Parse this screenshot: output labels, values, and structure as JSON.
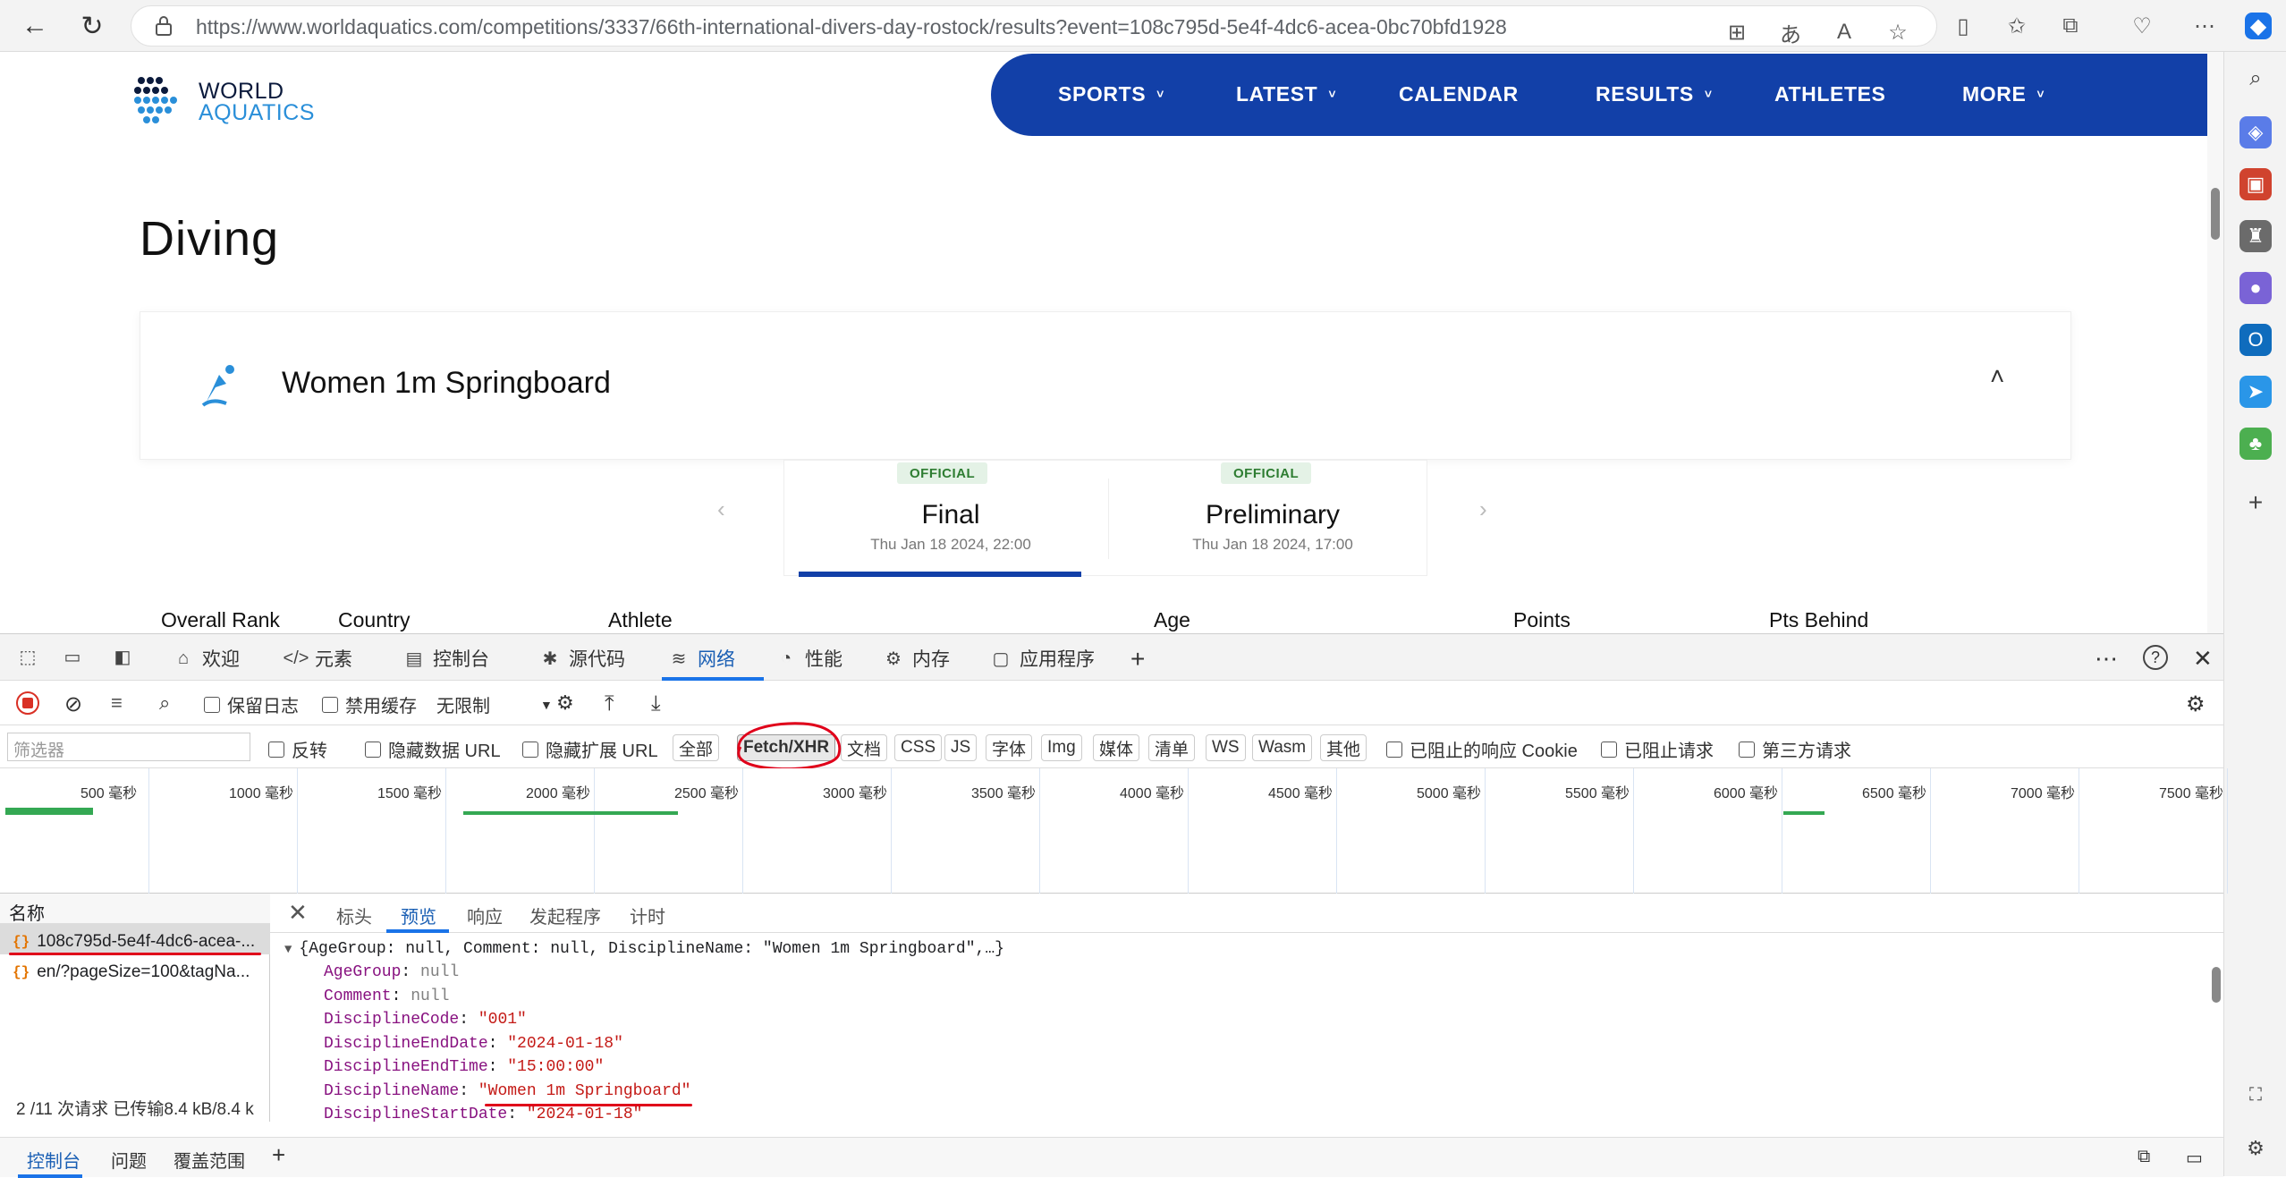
{
  "browser": {
    "url": "https://www.worldaquatics.com/competitions/3337/66th-international-divers-day-rostock/results?event=108c795d-5e4f-4dc6-acea-0bc70bfd1928"
  },
  "site": {
    "logo_line1": "WORLD",
    "logo_line2": "AQUATICS",
    "nav": [
      "SPORTS",
      "LATEST",
      "CALENDAR",
      "RESULTS",
      "ATHLETES",
      "MORE"
    ],
    "nav_chevron": "˅"
  },
  "page": {
    "title": "Diving",
    "event_name": "Women 1m Springboard",
    "collapse_icon": "˄",
    "phases": [
      {
        "badge": "OFFICIAL",
        "name": "Final",
        "date": "Thu Jan 18 2024, 22:00"
      },
      {
        "badge": "OFFICIAL",
        "name": "Preliminary",
        "date": "Thu Jan 18 2024, 17:00"
      }
    ],
    "arrow_left": "‹",
    "arrow_right": "›",
    "columns": [
      "Overall Rank",
      "Country",
      "Athlete",
      "Age",
      "Points",
      "Pts Behind"
    ]
  },
  "devtools": {
    "tabs": [
      "欢迎",
      "元素",
      "控制台",
      "源代码",
      "网络",
      "性能",
      "内存",
      "应用程序"
    ],
    "toolbar": {
      "preserve_log": "保留日志",
      "disable_cache": "禁用缓存",
      "throttle": "无限制"
    },
    "filter": {
      "placeholder": "筛选器",
      "invert": "反转",
      "hide_data_url": "隐藏数据 URL",
      "hide_ext_url": "隐藏扩展 URL",
      "types": [
        "全部",
        "Fetch/XHR",
        "文档",
        "CSS",
        "JS",
        "字体",
        "Img",
        "媒体",
        "清单",
        "WS",
        "Wasm",
        "其他"
      ],
      "selected": "Fetch/XHR",
      "blocked_cookies": "已阻止的响应 Cookie",
      "blocked_requests": "已阻止请求",
      "third_party": "第三方请求"
    },
    "timeline_ticks": [
      "500 毫秒",
      "1000 毫秒",
      "1500 毫秒",
      "2000 毫秒",
      "2500 毫秒",
      "3000 毫秒",
      "3500 毫秒",
      "4000 毫秒",
      "4500 毫秒",
      "5000 毫秒",
      "5500 毫秒",
      "6000 毫秒",
      "6500 毫秒",
      "7000 毫秒",
      "7500 毫秒"
    ],
    "requests_header": "名称",
    "requests": [
      "108c795d-5e4f-4dc6-acea-...",
      "en/?pageSize=100&tagNa..."
    ],
    "status": "2 /11 次请求   已传输8.4 kB/8.4 k",
    "detail_tabs": [
      "标头",
      "预览",
      "响应",
      "发起程序",
      "计时"
    ],
    "json_summary": "{AgeGroup: null, Comment: null, DisciplineName: \"Women 1m Springboard\",…}",
    "json_rows": [
      {
        "key": "AgeGroup",
        "value": "null",
        "type": "null"
      },
      {
        "key": "Comment",
        "value": "null",
        "type": "null"
      },
      {
        "key": "DisciplineCode",
        "value": "\"001\"",
        "type": "string"
      },
      {
        "key": "DisciplineEndDate",
        "value": "\"2024-01-18\"",
        "type": "string"
      },
      {
        "key": "DisciplineEndTime",
        "value": "\"15:00:00\"",
        "type": "string"
      },
      {
        "key": "DisciplineName",
        "value": "\"Women 1m Springboard\"",
        "type": "string"
      },
      {
        "key": "DisciplineStartDate",
        "value": "\"2024-01-18\"",
        "type": "string"
      }
    ],
    "drawer_tabs": [
      "控制台",
      "问题",
      "覆盖范围"
    ]
  }
}
